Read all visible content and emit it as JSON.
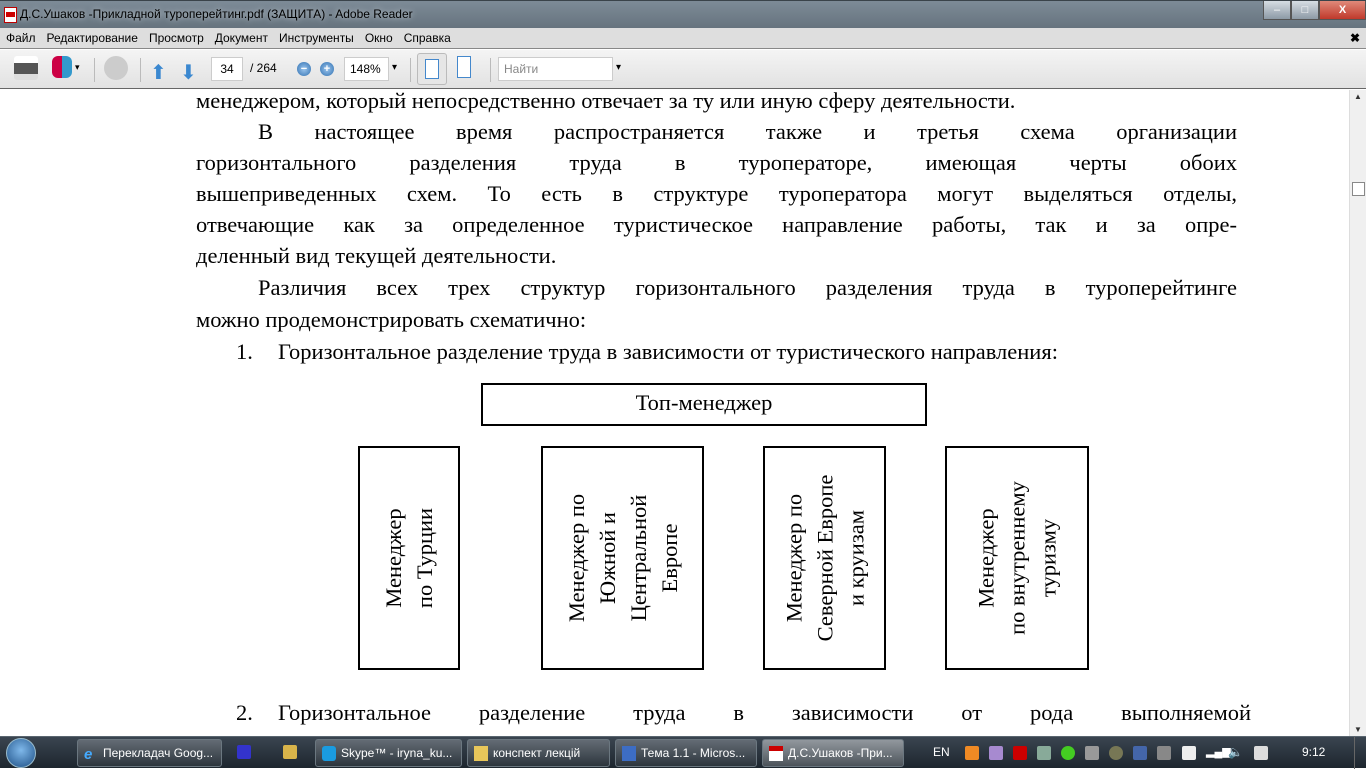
{
  "window": {
    "title": "Д.С.Ушаков -Прикладной туроперейтинг.pdf (ЗАЩИТА) - Adobe Reader",
    "min": "–",
    "max": "□",
    "close": "X"
  },
  "menu": {
    "items": [
      "Файл",
      "Редактирование",
      "Просмотр",
      "Документ",
      "Инструменты",
      "Окно",
      "Справка"
    ],
    "close": "✖"
  },
  "toolbar": {
    "page_current": "34",
    "page_total": "/ 264",
    "zoom": "148%",
    "find_placeholder": "Найти",
    "zoom_out": "−",
    "zoom_in": "+",
    "dropdown": "▾"
  },
  "document": {
    "lines": [
      "менеджером, который непосредственно отвечает за ту или иную сферу деятельности.",
      "В настоящее время распространяется также и третья схема организации",
      "горизонтального разделения труда в туроператоре, имеющая черты обоих",
      "вышеприведенных схем. То есть в структуре туроператора могут выделяться отделы,",
      "отвечающие как за определенное туристическое направление работы, так и за опре-",
      "деленный вид текущей деятельности.",
      "Различия всех трех структур горизонтального разделения труда в туроперейтинге",
      "можно продемонстрировать схематично:",
      "Горизонтальное разделение труда в зависимости от туристического направления:",
      "Горизонтальное разделение труда в зависимости от рода выполняемой"
    ],
    "item1_num": "1.",
    "item2_num": "2.",
    "diagram": {
      "top": "Топ-менеджер",
      "managers": [
        "Менеджер\nпо Турции",
        "Менеджер по\nЮжной и\nЦентральной\nЕвропе",
        "Менеджер по\nСеверной Европе\nи круизам",
        "Менеджер\nпо внутреннему\nтуризму"
      ]
    }
  },
  "taskbar": {
    "tasks": [
      "Перекладач Goog...",
      "Skype™ - iryna_ku...",
      "конспект лекцій",
      "Тема 1.1 - Micros...",
      "Д.С.Ушаков -При..."
    ],
    "lang": "EN",
    "clock": "9:12"
  }
}
